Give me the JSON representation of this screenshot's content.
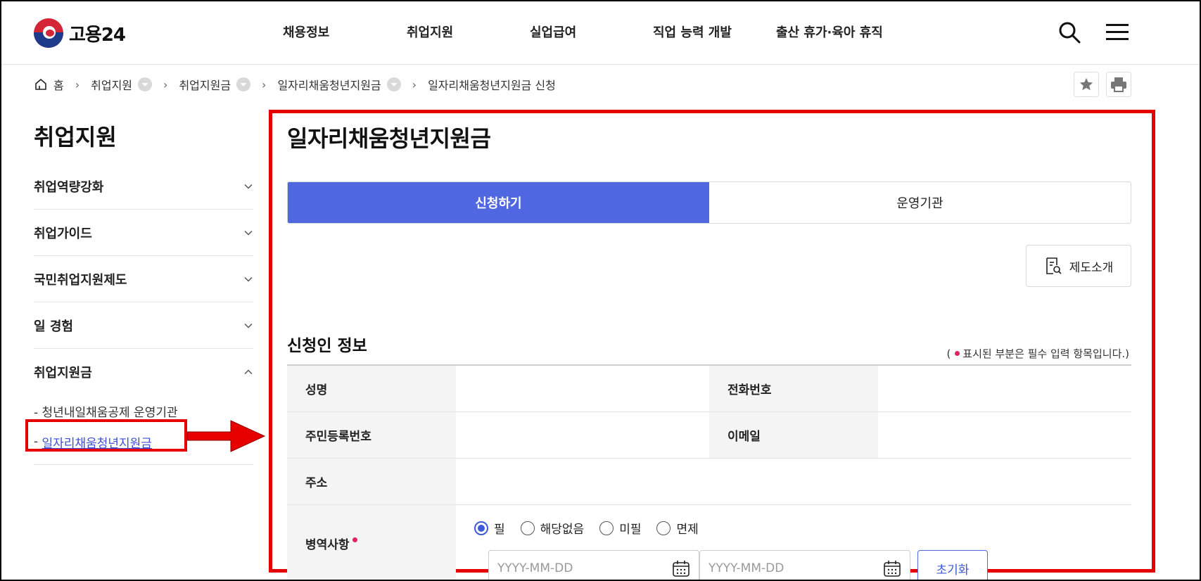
{
  "header": {
    "logo_text": "고용24",
    "nav": [
      "채용정보",
      "취업지원",
      "실업급여",
      "직업 능력 개발",
      "출산 휴가·육아 휴직"
    ]
  },
  "breadcrumb": {
    "home": "홈",
    "items": [
      "취업지원",
      "취업지원금",
      "일자리채움청년지원금",
      "일자리채움청년지원금 신청"
    ]
  },
  "sidebar": {
    "title": "취업지원",
    "items": [
      {
        "label": "취업역량강화"
      },
      {
        "label": "취업가이드"
      },
      {
        "label": "국민취업지원제도"
      },
      {
        "label": "일 경험"
      },
      {
        "label": "취업지원금"
      }
    ],
    "sub_items": [
      "- 청년내일채움공제 운영기관",
      "일자리채움청년지원금"
    ],
    "sub_prefix": "- "
  },
  "main": {
    "title": "일자리채움청년지원금",
    "tabs": [
      {
        "label": "신청하기",
        "active": true
      },
      {
        "label": "운영기관",
        "active": false
      }
    ],
    "intro_button": "제도소개",
    "section_title": "신청인 정보",
    "required_note_prefix": "(",
    "required_note_text": "표시된 부분은 필수 입력 항목입니다.)",
    "fields": {
      "name": "성명",
      "phone": "전화번호",
      "rrn": "주민등록번호",
      "email": "이메일",
      "address": "주소",
      "military": "병역사항"
    },
    "military_options": [
      "필",
      "해당없음",
      "미필",
      "면제"
    ],
    "date_placeholder": "YYYY-MM-DD",
    "reset_button": "초기화"
  },
  "colors": {
    "accent": "#4f67e0",
    "highlight": "#e60000",
    "required": "#e0245e"
  }
}
